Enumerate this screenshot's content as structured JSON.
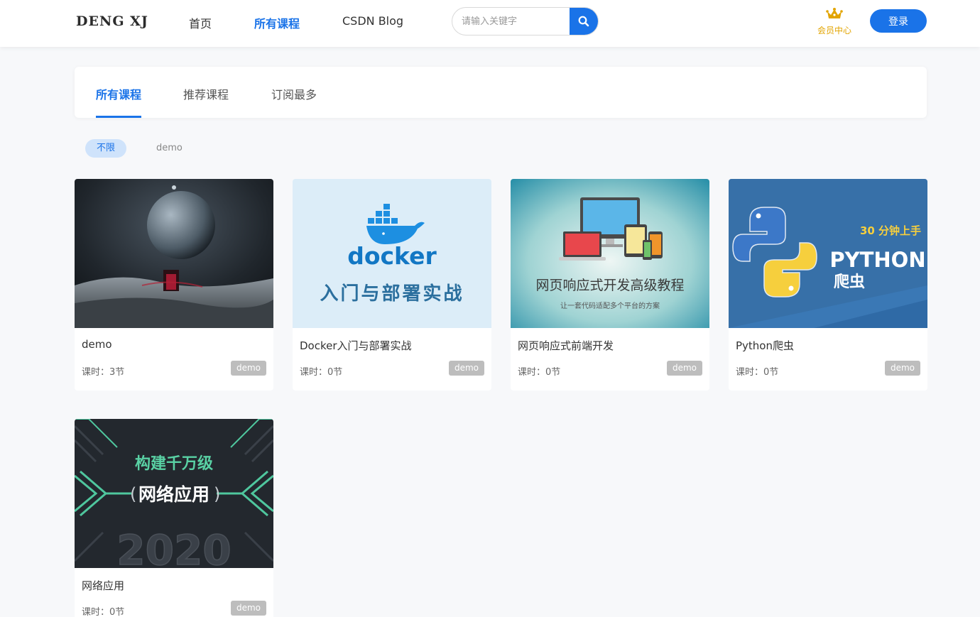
{
  "header": {
    "logo": "DENG XJ",
    "nav": [
      {
        "label": "首页"
      },
      {
        "label": "所有课程"
      },
      {
        "label": "CSDN Blog"
      }
    ],
    "search_placeholder": "请输入关键字",
    "vip_label": "会员中心",
    "login_label": "登录"
  },
  "tabs": [
    {
      "label": "所有课程"
    },
    {
      "label": "推荐课程"
    },
    {
      "label": "订阅最多"
    }
  ],
  "filters": [
    {
      "label": "不限"
    },
    {
      "label": "demo"
    }
  ],
  "courses": [
    {
      "title": "demo",
      "lessons": "课时：3节",
      "tag": "demo"
    },
    {
      "title": "Docker入门与部署实战",
      "lessons": "课时：0节",
      "tag": "demo",
      "cover": {
        "brand": "docker",
        "subtitle": "入门与部署实战"
      }
    },
    {
      "title": "网页响应式前端开发",
      "lessons": "课时：0节",
      "tag": "demo",
      "cover": {
        "heading": "网页响应式开发高级教程",
        "sub": "让一套代码适配多个平台的方案"
      }
    },
    {
      "title": "Python爬虫",
      "lessons": "课时：0节",
      "tag": "demo",
      "cover": {
        "badge": "30 分钟上手",
        "heading": "PYTHON",
        "sub": "爬虫"
      }
    },
    {
      "title": "网络应用",
      "lessons": "课时：0节",
      "tag": "demo",
      "cover": {
        "line1": "构建千万级",
        "line2": "网络应用",
        "year": "2020"
      }
    }
  ],
  "colors": {
    "accent": "#1a73e8",
    "vip": "#e2a400",
    "tag": "#bdbdbd"
  }
}
